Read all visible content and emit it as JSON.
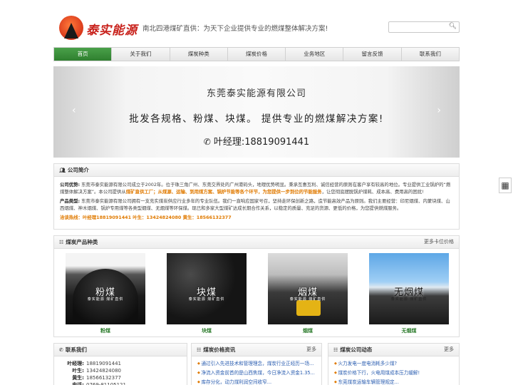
{
  "header": {
    "logo_text": "泰实能源",
    "slogan": "南北四港煤矿直供：为天下企业提供专业的燃煤整体解决方案!",
    "search": {
      "placeholder": ""
    }
  },
  "nav": {
    "items": [
      {
        "label": "首页",
        "active": true
      },
      {
        "label": "关于我们"
      },
      {
        "label": "煤炭种类"
      },
      {
        "label": "煤炭价格"
      },
      {
        "label": "业务地区"
      },
      {
        "label": "留言反馈"
      },
      {
        "label": "联系我们"
      }
    ]
  },
  "banner": {
    "company": "东莞泰实能源有限公司",
    "main": "批发各规格、粉煤、块煤。 提供专业的燃煤解决方案!",
    "phone": "叶经理:18819091441"
  },
  "intro": {
    "title": "公司简介",
    "p1_label": "公司优势:",
    "p1_text_a": "东莞市泰实能源有限公司成立于2002年。位于珠三角广州、东莞交界处的广州港码头，地理优势明显。秉承互惠互利、诚信经营的原则在客户享有较高的地位。专业提供工业锅炉的“燃煤整体解决方案”。本公司提供从",
    "p1_hl1": "煤矿直供工厂；从煤源、运输、到用煤方案、锅炉节能等各个环节，为您提供一步到位的节能服务",
    "p1_text_b": "，让您彻底摆脱锅炉煤耗、成本高、费用高的困扰!",
    "p2_label": "产品类型:",
    "p2_text": "东莞市泰实能源有限公司拥有一支充实煤炭供应行业多年的专业队伍。我们一直响应国家号召，坚持走环保创新之路，造节能高效产品为原则。我们主要经营：印尼烟煤、内蒙块煤、山西烟煤、神木烟煤、锅炉专用煤等各类型烟煤、无烟煤等环保煤。现已和多家大型煤矿达成长期合作关系，以稳定的质量、充足的货源、更低的价格，为您提供燃煤服务。",
    "contact_line": "洽谈热线：叶经理18819091441 叶生：13424824080 黄生：18566132377"
  },
  "products": {
    "title": "煤炭产品种类",
    "more": "更多卡位价格",
    "items": [
      {
        "title": "粉煤",
        "sub": "泰实能源 煤矿直供",
        "label": "粉煤"
      },
      {
        "title": "块煤",
        "sub": "泰实能源 煤矿直供",
        "label": "块煤"
      },
      {
        "title": "烟煤",
        "sub": "泰实能源 煤矿直供",
        "label": "烟煤"
      },
      {
        "title": "无烟煤",
        "sub": "泰实能源 煤矿直供",
        "label": "无烟煤"
      }
    ]
  },
  "contact": {
    "title": "联系我们",
    "rows": [
      {
        "key": "叶经理:",
        "val": "18819091441"
      },
      {
        "key": "叶生:",
        "val": "13424824080"
      },
      {
        "key": "黄生:",
        "val": "18566132377"
      },
      {
        "key": "电话:",
        "val": "0769-81105121"
      }
    ]
  },
  "news": {
    "title": "煤炭价格资讯",
    "more": "更多",
    "items": [
      "通过引入先进技术和管理理念，煤炭行业正经历一场...",
      "净流入资金前首的是山西焦煤，今日净流入资金1.35...",
      "库存分化，动力煤利润空间收窄..."
    ]
  },
  "dyn": {
    "title": "煤炭公司动态",
    "more": "更多",
    "items": [
      "火力发电一度电消耗多少煤?",
      "煤炭价格下行，火电用煤成本压力缓解!",
      "东莞煤炭运输车辆管理规定..."
    ]
  },
  "side": {
    "qr_icon": "qr-code-icon"
  }
}
